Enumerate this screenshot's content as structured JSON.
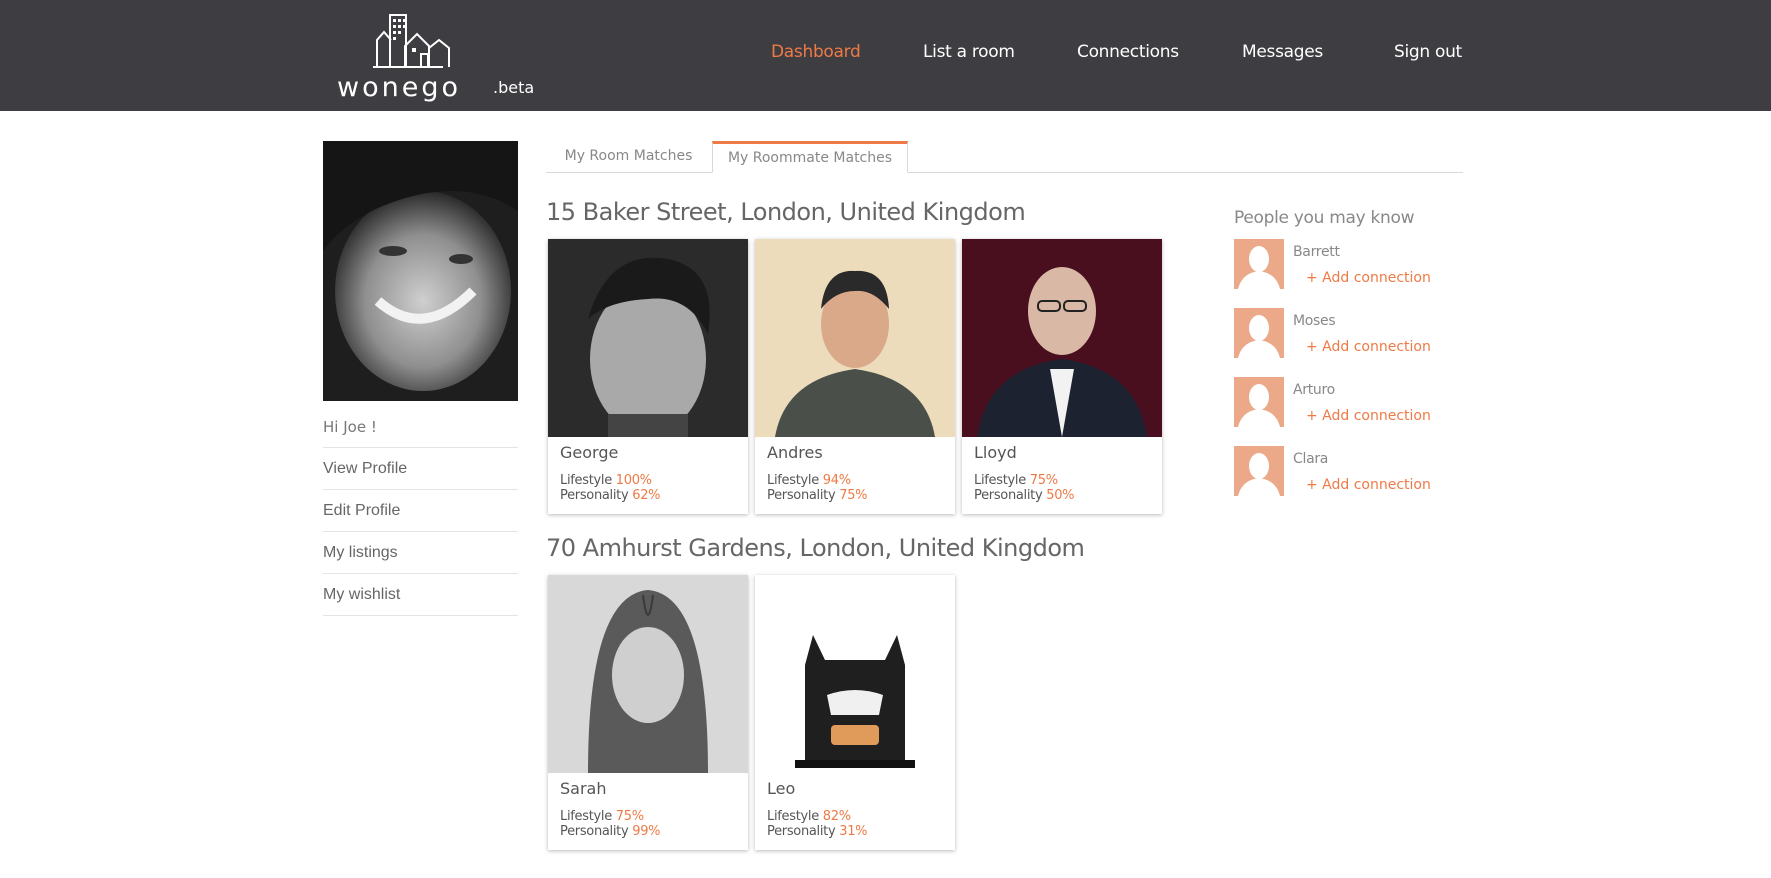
{
  "brand": {
    "name": "wonego",
    "suffix": ".beta"
  },
  "colors": {
    "accent": "#ee7a45",
    "header_bg": "#3e3e42",
    "avatar_placeholder": "#eba98a"
  },
  "nav": {
    "dashboard": "Dashboard",
    "list_room": "List a room",
    "connections": "Connections",
    "messages": "Messages",
    "sign_out": "Sign out"
  },
  "sidebar": {
    "greeting": "Hi Joe !",
    "items": [
      {
        "label": "View Profile"
      },
      {
        "label": "Edit Profile"
      },
      {
        "label": "My listings"
      },
      {
        "label": "My wishlist"
      }
    ]
  },
  "tabs": {
    "room_matches": "My Room Matches",
    "roommate_matches": "My Roommate Matches"
  },
  "listings": [
    {
      "address": "15 Baker Street, London, United Kingdom",
      "matches": [
        {
          "name": "George",
          "lifestyle": "100%",
          "personality": "62%"
        },
        {
          "name": "Andres",
          "lifestyle": "94%",
          "personality": "75%"
        },
        {
          "name": "Lloyd",
          "lifestyle": "75%",
          "personality": "50%"
        }
      ]
    },
    {
      "address": "70 Amhurst Gardens, London, United Kingdom",
      "matches": [
        {
          "name": "Sarah",
          "lifestyle": "75%",
          "personality": "99%"
        },
        {
          "name": "Leo",
          "lifestyle": "82%",
          "personality": "31%"
        }
      ]
    }
  ],
  "labels": {
    "lifestyle": "Lifestyle",
    "personality": "Personality"
  },
  "people_you_may_know": {
    "title": "People you may know",
    "add_label": "+ Add connection",
    "people": [
      {
        "name": "Barrett"
      },
      {
        "name": "Moses"
      },
      {
        "name": "Arturo"
      },
      {
        "name": "Clara"
      }
    ]
  }
}
